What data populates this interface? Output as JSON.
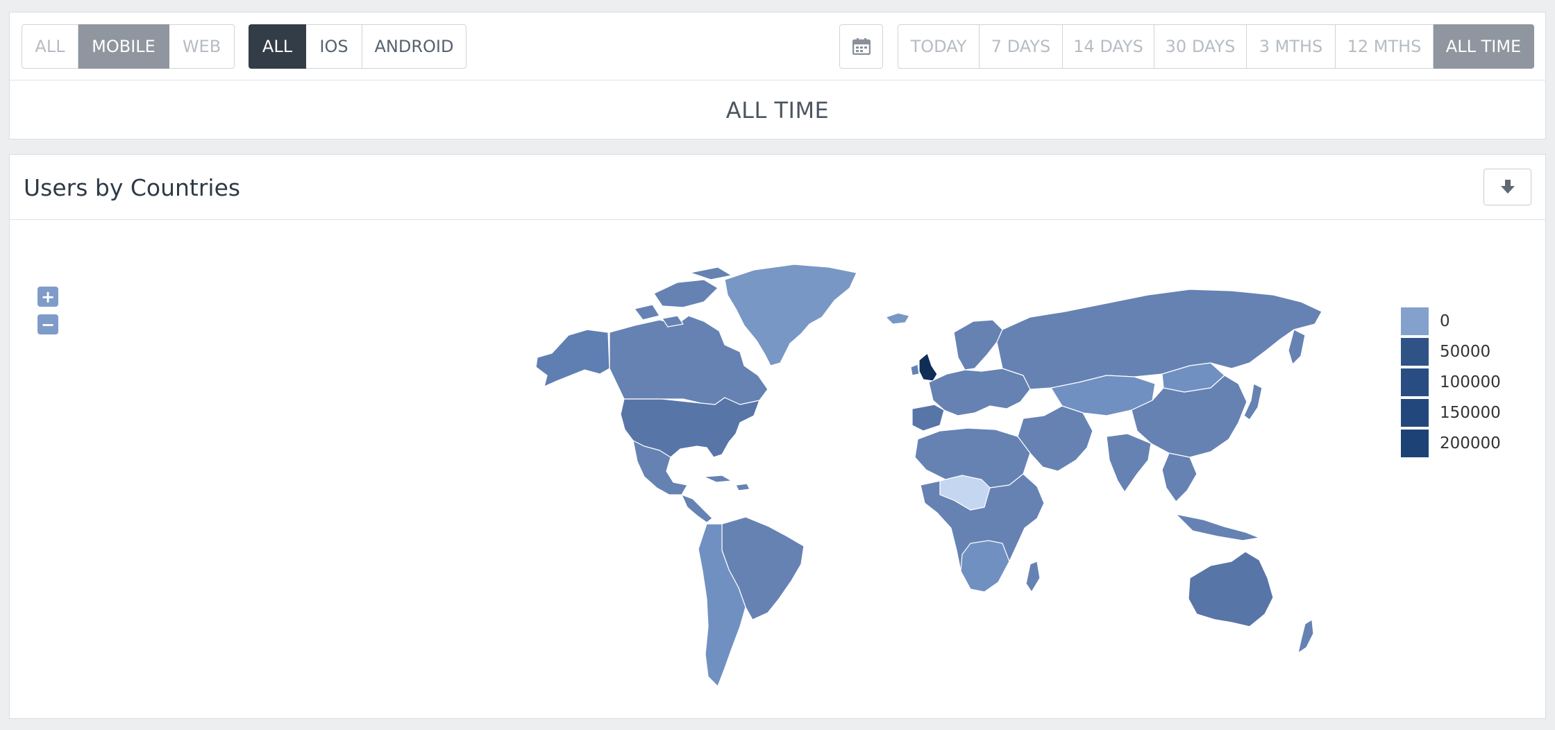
{
  "platform_filter": {
    "all": "ALL",
    "mobile": "MOBILE",
    "web": "WEB"
  },
  "os_filter": {
    "all": "ALL",
    "ios": "IOS",
    "android": "ANDROID"
  },
  "date_filter": {
    "calendar_icon": "calendar-icon",
    "options": [
      "TODAY",
      "7 DAYS",
      "14 DAYS",
      "30 DAYS",
      "3 MTHS",
      "12 MTHS",
      "ALL TIME"
    ],
    "selected": "ALL TIME"
  },
  "period_title": "ALL TIME",
  "map_card": {
    "title": "Users by Countries",
    "download_icon": "download-icon",
    "zoom_in": "+",
    "zoom_out": "−",
    "legend": [
      {
        "label": "0",
        "color": "#84a1cd"
      },
      {
        "label": "50000",
        "color": "#2f5386"
      },
      {
        "label": "100000",
        "color": "#294d82"
      },
      {
        "label": "150000",
        "color": "#22477c"
      },
      {
        "label": "200000",
        "color": "#1d4276"
      }
    ]
  },
  "colors": {
    "map_fill_default": "#6582b3",
    "map_fill_light": "#7897c5",
    "map_fill_lightest": "#c4d6f0",
    "map_fill_darkest": "#0f2d57",
    "active_dark_button": "#333d48",
    "active_grey_button": "#8f969f"
  }
}
